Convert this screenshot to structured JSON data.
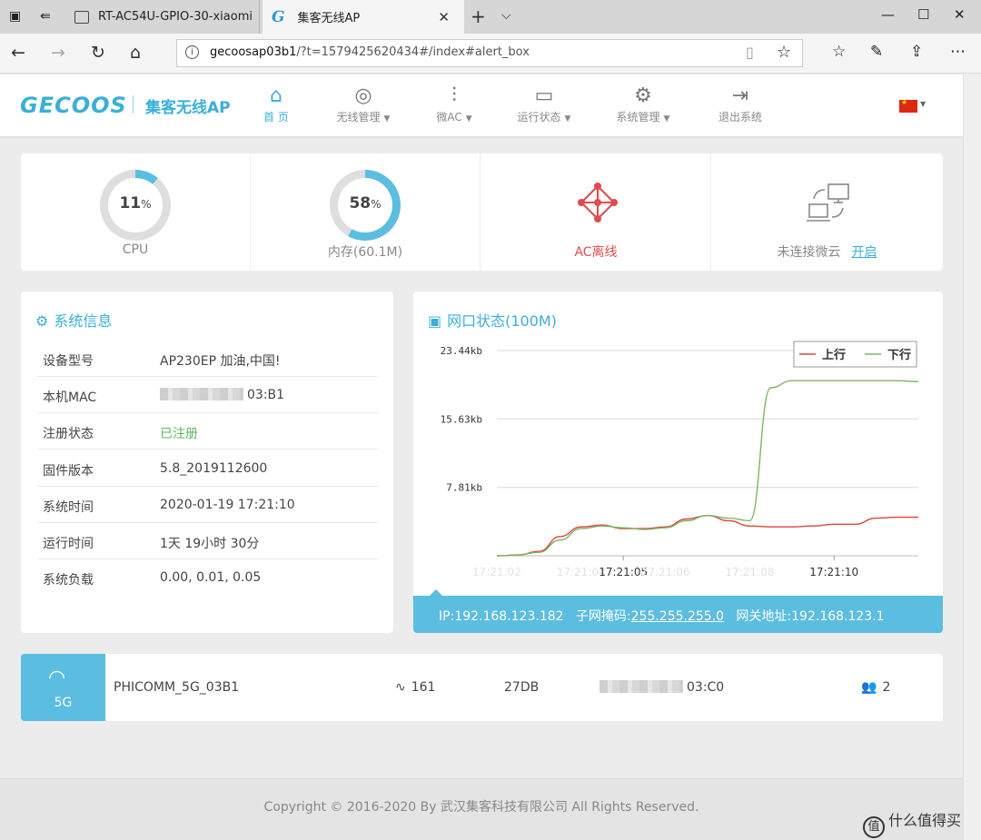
{
  "browser": {
    "tabs": [
      {
        "title": "RT-AC54U-GPIO-30-xiaomi",
        "active": false
      },
      {
        "title": "集客无线AP",
        "active": true
      }
    ],
    "url": {
      "host": "gecoosap03b1",
      "path": "/?t=1579425620434#/index#alert_box"
    }
  },
  "header": {
    "logo": "GECOOS",
    "product": "集客无线AP",
    "menu": [
      {
        "label": "首 页",
        "icon": "home-icon",
        "active": true,
        "dropdown": false
      },
      {
        "label": "无线管理",
        "icon": "wifi-signal-icon",
        "active": false,
        "dropdown": true
      },
      {
        "label": "微AC",
        "icon": "sliders-icon",
        "active": false,
        "dropdown": true
      },
      {
        "label": "运行状态",
        "icon": "monitor-icon",
        "active": false,
        "dropdown": true
      },
      {
        "label": "系统管理",
        "icon": "gear-icon",
        "active": false,
        "dropdown": true
      },
      {
        "label": "退出系统",
        "icon": "logout-icon",
        "active": false,
        "dropdown": false
      }
    ]
  },
  "stats": {
    "cpu": {
      "value": 11,
      "unit": "%",
      "label": "CPU"
    },
    "memory": {
      "value": 58,
      "unit": "%",
      "label": "内存(60.1M)"
    },
    "ac": {
      "label": "AC离线"
    },
    "cloud": {
      "label": "未连接微云",
      "action": "开启"
    }
  },
  "system_info": {
    "title": "系统信息",
    "rows": [
      {
        "key": "设备型号",
        "value": "AP230EP 加油,中国!",
        "redacted": false
      },
      {
        "key": "本机MAC",
        "value": "03:B1",
        "redacted": true
      },
      {
        "key": "注册状态",
        "value": "已注册",
        "redacted": false,
        "status": "ok"
      },
      {
        "key": "固件版本",
        "value": "5.8_2019112600",
        "redacted": false
      },
      {
        "key": "系统时间",
        "value": "2020-01-19 17:21:10",
        "redacted": false
      },
      {
        "key": "运行时间",
        "value": "1天 19小时 30分",
        "redacted": false
      },
      {
        "key": "系统负载",
        "value": "0.00, 0.01, 0.05",
        "redacted": false
      }
    ]
  },
  "network": {
    "title": "网口状态(100M)",
    "ip_label": "IP:",
    "ip": "192.168.123.182",
    "mask_label": "子网掩码:",
    "mask": "255.255.255.0",
    "gateway_label": "网关地址:",
    "gateway": "192.168.123.1"
  },
  "chart_data": {
    "type": "line",
    "yticks": [
      "23.44kb",
      "15.63kb",
      "7.81kb"
    ],
    "ytick_values": [
      23.44,
      15.63,
      7.81
    ],
    "ylim": [
      0,
      23.44
    ],
    "x": [
      0,
      0.5,
      1,
      1.5,
      2,
      2.5,
      3,
      3.5,
      4,
      4.5,
      5,
      5.5,
      6,
      6.5,
      7,
      7.5,
      8,
      8.5,
      9,
      9.5,
      10
    ],
    "xticks": [
      {
        "x": 0,
        "label": "17:21:02",
        "faded": true
      },
      {
        "x": 2,
        "label": "17:21:04",
        "faded": true
      },
      {
        "x": 3,
        "label": "17:21:05",
        "faded": false
      },
      {
        "x": 4,
        "label": "17:21:06",
        "faded": true
      },
      {
        "x": 6,
        "label": "17:21:08",
        "faded": true
      },
      {
        "x": 8,
        "label": "17:21:10",
        "faded": false
      }
    ],
    "series": [
      {
        "name": "上行",
        "color": "#e0443a",
        "values": [
          0,
          0.1,
          0.5,
          2.2,
          3.3,
          3.5,
          3.1,
          3.1,
          3.3,
          4.2,
          4.6,
          4.0,
          3.4,
          3.3,
          3.3,
          3.4,
          3.6,
          3.6,
          4.3,
          4.4,
          4.4
        ]
      },
      {
        "name": "下行",
        "color": "#7bb661",
        "values": [
          0,
          0.1,
          0.4,
          1.8,
          3.1,
          3.4,
          3.2,
          3.0,
          3.2,
          4.0,
          4.6,
          4.3,
          4.0,
          19.2,
          20.0,
          20.0,
          20.0,
          20.0,
          20.0,
          20.0,
          19.9
        ]
      }
    ],
    "legend_position": "top-right",
    "grid": true
  },
  "ssid": {
    "band": "5G",
    "name": "PHICOMM_5G_03B1",
    "signal": "161",
    "power": "27DB",
    "mac": "03:C0",
    "clients": "2"
  },
  "footer": {
    "copyright": "Copyright © 2016-2020 By 武汉集客科技有限公司 All Rights Reserved."
  },
  "watermark": {
    "symbol": "值",
    "text": "什么值得买"
  }
}
